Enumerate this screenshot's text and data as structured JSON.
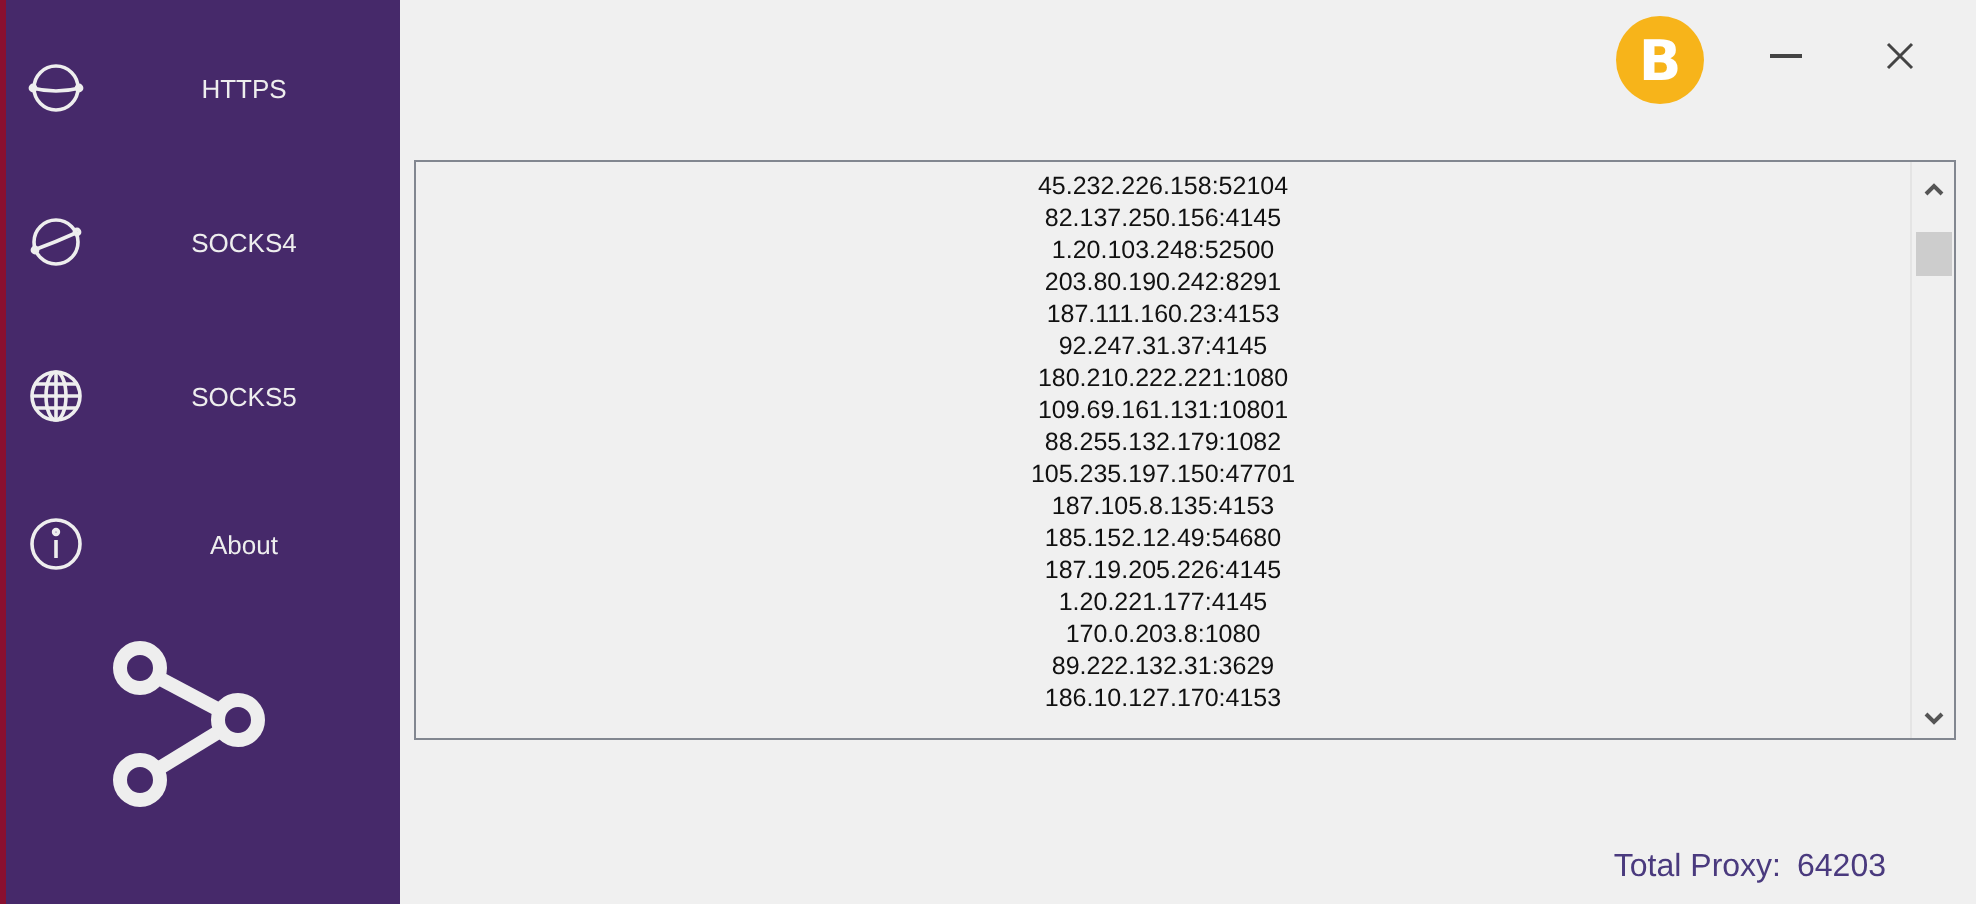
{
  "sidebar": {
    "items": [
      {
        "label": "HTTPS"
      },
      {
        "label": "SOCKS4"
      },
      {
        "label": "SOCKS5"
      },
      {
        "label": "About"
      }
    ]
  },
  "title_bar": {
    "donate_label": "B"
  },
  "proxy_list": [
    "45.232.226.158:52104",
    "82.137.250.156:4145",
    "1.20.103.248:52500",
    "203.80.190.242:8291",
    "187.111.160.23:4153",
    "92.247.31.37:4145",
    "180.210.222.221:1080",
    "109.69.161.131:10801",
    "88.255.132.179:1082",
    "105.235.197.150:47701",
    "187.105.8.135:4153",
    "185.152.12.49:54680",
    "187.19.205.226:4145",
    "1.20.221.177:4145",
    "170.0.203.8:1080",
    "89.222.132.31:3629",
    "186.10.127.170:4153"
  ],
  "total": {
    "label": "Total Proxy:",
    "value": "64203"
  }
}
